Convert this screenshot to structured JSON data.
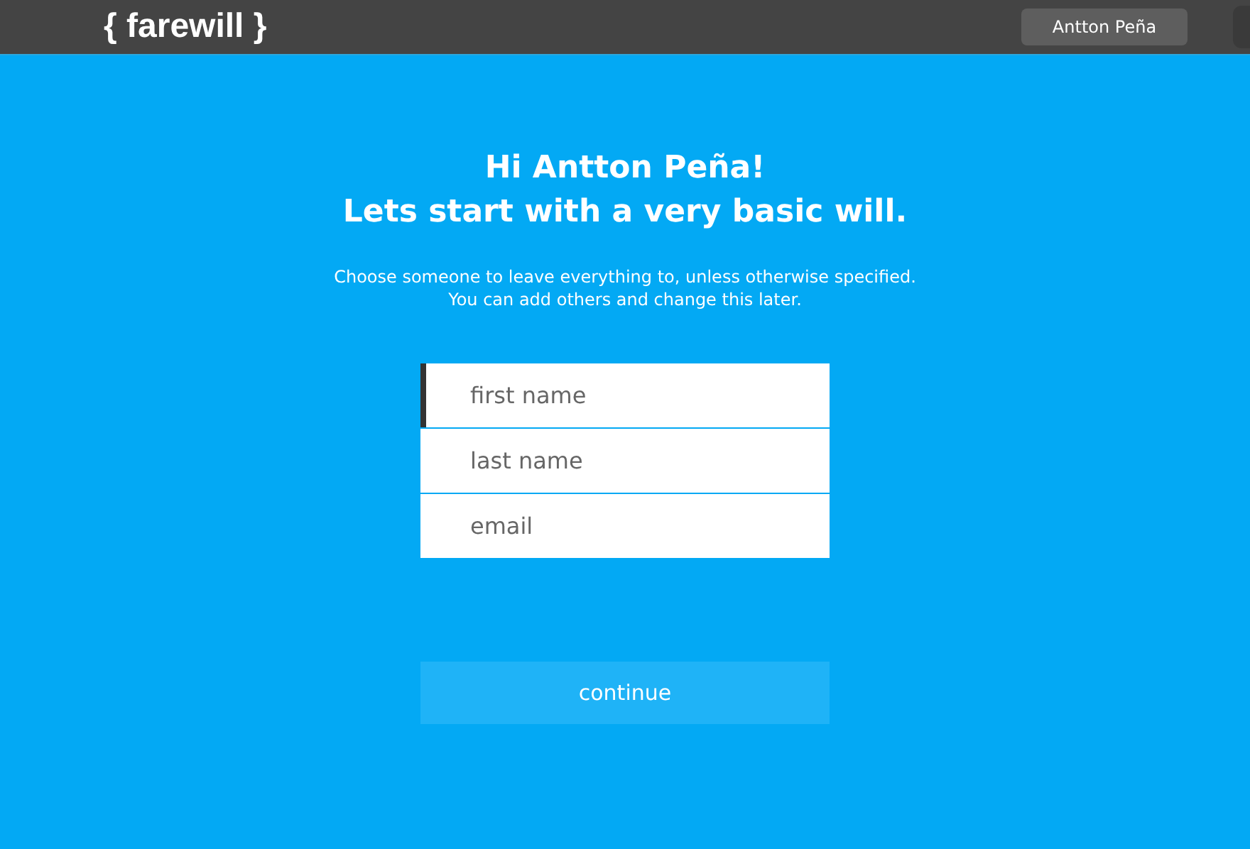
{
  "header": {
    "logo": "{ farewill }",
    "user_button": "Antton Peña"
  },
  "heading": [
    "Hi Antton Peña!",
    "Lets start with a very basic will."
  ],
  "subtitle": [
    "Choose someone to leave everything to, unless otherwise specified.",
    "You can add others and change this later."
  ],
  "fields": [
    {
      "placeholder": "first name",
      "focused": true
    },
    {
      "placeholder": "last name",
      "focused": false
    },
    {
      "placeholder": "email",
      "focused": false
    }
  ],
  "continue_button": "continue"
}
